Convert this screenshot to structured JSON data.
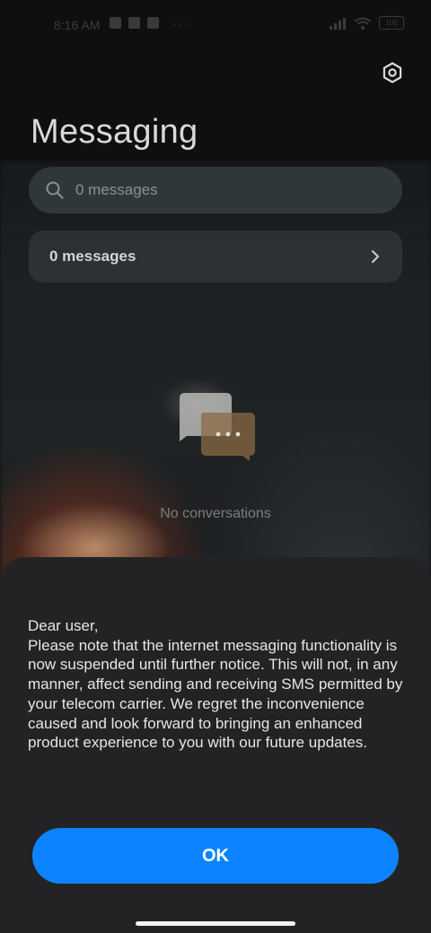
{
  "status_bar": {
    "time": "8:16 AM",
    "battery": "100",
    "more": "···",
    "icons": [
      "signal-icon",
      "wifi-icon",
      "battery-icon"
    ]
  },
  "header": {
    "title": "Messaging",
    "settings_icon": "settings-gear-icon"
  },
  "search": {
    "placeholder": "0 messages",
    "icon": "search-icon"
  },
  "summary_row": {
    "label": "0 messages",
    "icon": "chevron-right-icon"
  },
  "empty_state": {
    "text": "No conversations",
    "icon": "chat-bubbles-icon"
  },
  "dialog": {
    "message": "Dear user,\nPlease note that the internet messaging functionality is now suspended until further notice. This will not, in any manner, affect sending and receiving SMS permitted by your telecom carrier. We regret the inconvenience caused and look forward to bringing an enhanced product experience to you with our future updates.",
    "ok_label": "OK"
  },
  "colors": {
    "accent": "#0d84ff",
    "sheet_bg": "#232326"
  }
}
